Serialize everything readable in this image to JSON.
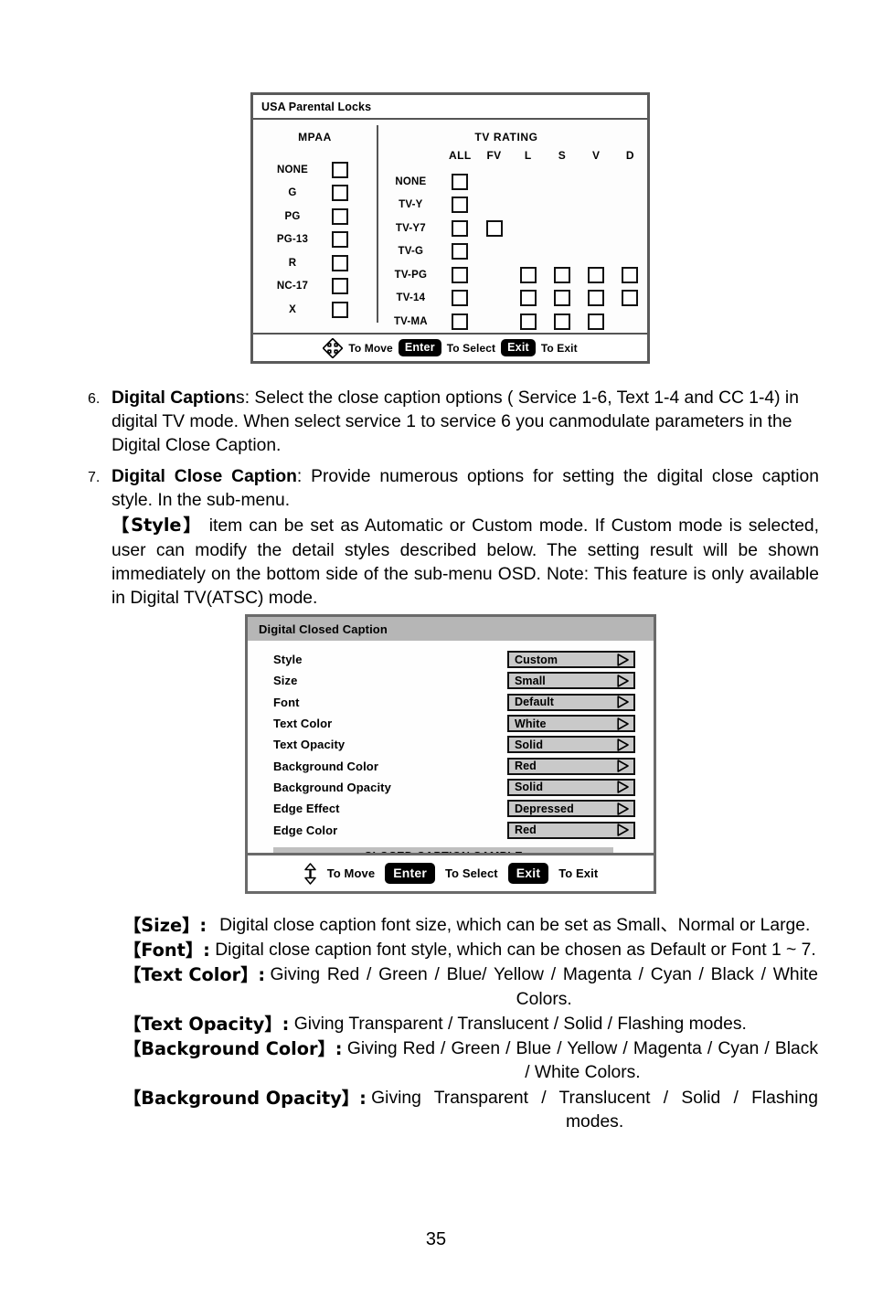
{
  "page": {
    "number": "35"
  },
  "figure_parental": {
    "title": "USA Parental Locks",
    "mpaa_heading": "MPAA",
    "tv_heading": "TV RATING",
    "tv_columns": [
      "ALL",
      "FV",
      "L",
      "S",
      "V",
      "D"
    ],
    "mpaa_rows": [
      {
        "label": "NONE"
      },
      {
        "label": "G"
      },
      {
        "label": "PG"
      },
      {
        "label": "PG-13"
      },
      {
        "label": "R"
      },
      {
        "label": "NC-17"
      },
      {
        "label": "X"
      }
    ],
    "tv_rows": [
      {
        "label": "NONE",
        "boxes": [
          true,
          false,
          false,
          false,
          false,
          false
        ]
      },
      {
        "label": "TV-Y",
        "boxes": [
          true,
          false,
          false,
          false,
          false,
          false
        ]
      },
      {
        "label": "TV-Y7",
        "boxes": [
          true,
          true,
          false,
          false,
          false,
          false
        ]
      },
      {
        "label": "TV-G",
        "boxes": [
          true,
          false,
          false,
          false,
          false,
          false
        ]
      },
      {
        "label": "TV-PG",
        "boxes": [
          true,
          false,
          true,
          true,
          true,
          true
        ]
      },
      {
        "label": "TV-14",
        "boxes": [
          true,
          false,
          true,
          true,
          true,
          true
        ]
      },
      {
        "label": "TV-MA",
        "boxes": [
          true,
          false,
          true,
          true,
          true,
          false
        ]
      }
    ],
    "footer": {
      "move_icon": "dpad-four-way-arrow-icon",
      "move_label": "To Move",
      "enter_key": "Enter",
      "select_label": "To Select",
      "exit_key": "Exit",
      "exit_label": "To Exit"
    }
  },
  "item6": {
    "number": "6.",
    "term": "Digital Caption",
    "text": "s: Select the close caption options ( Service 1-6, Text 1-4 and CC 1-4) in digital TV mode. When select service 1 to service 6 you canmodulate parameters in the Digital Close Caption."
  },
  "item7": {
    "number": "7.",
    "term": "Digital Close Caption",
    "text": ": Provide numerous options for setting the digital close caption style. In the sub-menu.",
    "style_block_term": "【Style】",
    "style_block_text": " item can be set as Automatic or Custom mode. If Custom mode is selected, user can modify the detail styles described below. The setting result will be shown immediately on the bottom side of the sub-menu OSD. Note: This feature is only available in Digital TV(ATSC) mode."
  },
  "figure_dcc": {
    "title": "Digital Closed Caption",
    "rows": [
      {
        "label": "Style",
        "value": "Custom"
      },
      {
        "label": "Size",
        "value": "Small"
      },
      {
        "label": "Font",
        "value": "Default"
      },
      {
        "label": "Text Color",
        "value": "White"
      },
      {
        "label": "Text Opacity",
        "value": "Solid"
      },
      {
        "label": "Background Color",
        "value": "Red"
      },
      {
        "label": "Background Opacity",
        "value": "Solid"
      },
      {
        "label": "Edge Effect",
        "value": "Depressed"
      },
      {
        "label": "Edge Color",
        "value": "Red"
      }
    ],
    "sample_text": "CLOSED CAPTION SAMPLE",
    "footer": {
      "move_icon": "up-down-arrow-icon",
      "move_label": "To Move",
      "enter_key": "Enter",
      "select_label": "To Select",
      "exit_key": "Exit",
      "exit_label": "To Exit"
    }
  },
  "definitions": [
    {
      "term": "【Size】:",
      "desc": "Digital close caption font size, which can be set as Small、Normal or Large."
    },
    {
      "term": "【Font】:",
      "desc": "Digital close caption font style, which can be chosen as Default or Font 1 ~ 7."
    },
    {
      "term": "【Text Color】:",
      "desc": "Giving Red / Green / Blue/ Yellow / Magenta / Cyan / Black / White Colors."
    },
    {
      "term": "【Text Opacity】:",
      "desc": "Giving Transparent / Translucent / Solid / Flashing modes."
    },
    {
      "term": "【Background Color】:",
      "desc": "Giving Red / Green / Blue / Yellow / Magenta / Cyan / Black / White Colors."
    },
    {
      "term": "【Background Opacity】:",
      "desc": "Giving Transparent / Translucent / Solid / Flashing modes."
    }
  ]
}
